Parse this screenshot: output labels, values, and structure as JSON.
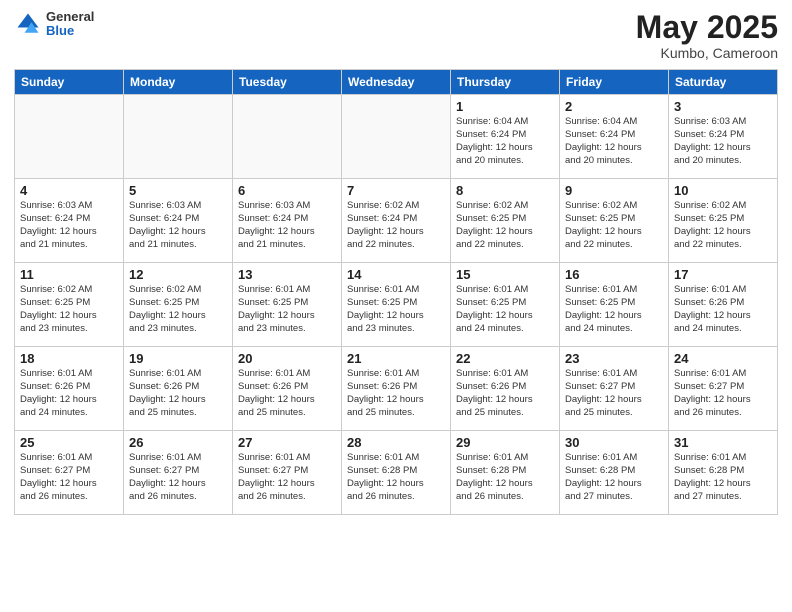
{
  "header": {
    "logo_general": "General",
    "logo_blue": "Blue",
    "month_year": "May 2025",
    "location": "Kumbo, Cameroon"
  },
  "days_of_week": [
    "Sunday",
    "Monday",
    "Tuesday",
    "Wednesday",
    "Thursday",
    "Friday",
    "Saturday"
  ],
  "weeks": [
    [
      {
        "day": "",
        "text": ""
      },
      {
        "day": "",
        "text": ""
      },
      {
        "day": "",
        "text": ""
      },
      {
        "day": "",
        "text": ""
      },
      {
        "day": "1",
        "text": "Sunrise: 6:04 AM\nSunset: 6:24 PM\nDaylight: 12 hours\nand 20 minutes."
      },
      {
        "day": "2",
        "text": "Sunrise: 6:04 AM\nSunset: 6:24 PM\nDaylight: 12 hours\nand 20 minutes."
      },
      {
        "day": "3",
        "text": "Sunrise: 6:03 AM\nSunset: 6:24 PM\nDaylight: 12 hours\nand 20 minutes."
      }
    ],
    [
      {
        "day": "4",
        "text": "Sunrise: 6:03 AM\nSunset: 6:24 PM\nDaylight: 12 hours\nand 21 minutes."
      },
      {
        "day": "5",
        "text": "Sunrise: 6:03 AM\nSunset: 6:24 PM\nDaylight: 12 hours\nand 21 minutes."
      },
      {
        "day": "6",
        "text": "Sunrise: 6:03 AM\nSunset: 6:24 PM\nDaylight: 12 hours\nand 21 minutes."
      },
      {
        "day": "7",
        "text": "Sunrise: 6:02 AM\nSunset: 6:24 PM\nDaylight: 12 hours\nand 22 minutes."
      },
      {
        "day": "8",
        "text": "Sunrise: 6:02 AM\nSunset: 6:25 PM\nDaylight: 12 hours\nand 22 minutes."
      },
      {
        "day": "9",
        "text": "Sunrise: 6:02 AM\nSunset: 6:25 PM\nDaylight: 12 hours\nand 22 minutes."
      },
      {
        "day": "10",
        "text": "Sunrise: 6:02 AM\nSunset: 6:25 PM\nDaylight: 12 hours\nand 22 minutes."
      }
    ],
    [
      {
        "day": "11",
        "text": "Sunrise: 6:02 AM\nSunset: 6:25 PM\nDaylight: 12 hours\nand 23 minutes."
      },
      {
        "day": "12",
        "text": "Sunrise: 6:02 AM\nSunset: 6:25 PM\nDaylight: 12 hours\nand 23 minutes."
      },
      {
        "day": "13",
        "text": "Sunrise: 6:01 AM\nSunset: 6:25 PM\nDaylight: 12 hours\nand 23 minutes."
      },
      {
        "day": "14",
        "text": "Sunrise: 6:01 AM\nSunset: 6:25 PM\nDaylight: 12 hours\nand 23 minutes."
      },
      {
        "day": "15",
        "text": "Sunrise: 6:01 AM\nSunset: 6:25 PM\nDaylight: 12 hours\nand 24 minutes."
      },
      {
        "day": "16",
        "text": "Sunrise: 6:01 AM\nSunset: 6:25 PM\nDaylight: 12 hours\nand 24 minutes."
      },
      {
        "day": "17",
        "text": "Sunrise: 6:01 AM\nSunset: 6:26 PM\nDaylight: 12 hours\nand 24 minutes."
      }
    ],
    [
      {
        "day": "18",
        "text": "Sunrise: 6:01 AM\nSunset: 6:26 PM\nDaylight: 12 hours\nand 24 minutes."
      },
      {
        "day": "19",
        "text": "Sunrise: 6:01 AM\nSunset: 6:26 PM\nDaylight: 12 hours\nand 25 minutes."
      },
      {
        "day": "20",
        "text": "Sunrise: 6:01 AM\nSunset: 6:26 PM\nDaylight: 12 hours\nand 25 minutes."
      },
      {
        "day": "21",
        "text": "Sunrise: 6:01 AM\nSunset: 6:26 PM\nDaylight: 12 hours\nand 25 minutes."
      },
      {
        "day": "22",
        "text": "Sunrise: 6:01 AM\nSunset: 6:26 PM\nDaylight: 12 hours\nand 25 minutes."
      },
      {
        "day": "23",
        "text": "Sunrise: 6:01 AM\nSunset: 6:27 PM\nDaylight: 12 hours\nand 25 minutes."
      },
      {
        "day": "24",
        "text": "Sunrise: 6:01 AM\nSunset: 6:27 PM\nDaylight: 12 hours\nand 26 minutes."
      }
    ],
    [
      {
        "day": "25",
        "text": "Sunrise: 6:01 AM\nSunset: 6:27 PM\nDaylight: 12 hours\nand 26 minutes."
      },
      {
        "day": "26",
        "text": "Sunrise: 6:01 AM\nSunset: 6:27 PM\nDaylight: 12 hours\nand 26 minutes."
      },
      {
        "day": "27",
        "text": "Sunrise: 6:01 AM\nSunset: 6:27 PM\nDaylight: 12 hours\nand 26 minutes."
      },
      {
        "day": "28",
        "text": "Sunrise: 6:01 AM\nSunset: 6:28 PM\nDaylight: 12 hours\nand 26 minutes."
      },
      {
        "day": "29",
        "text": "Sunrise: 6:01 AM\nSunset: 6:28 PM\nDaylight: 12 hours\nand 26 minutes."
      },
      {
        "day": "30",
        "text": "Sunrise: 6:01 AM\nSunset: 6:28 PM\nDaylight: 12 hours\nand 27 minutes."
      },
      {
        "day": "31",
        "text": "Sunrise: 6:01 AM\nSunset: 6:28 PM\nDaylight: 12 hours\nand 27 minutes."
      }
    ]
  ]
}
